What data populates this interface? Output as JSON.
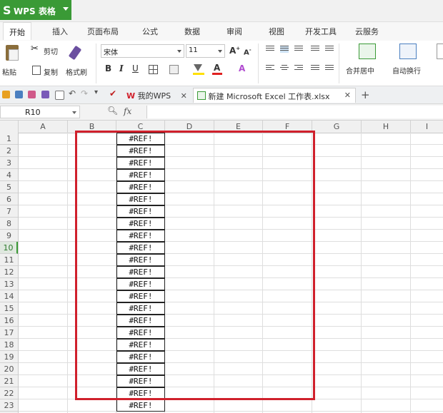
{
  "app": {
    "logo": "S",
    "name": "WPS 表格"
  },
  "ribbon_tabs": [
    "开始",
    "插入",
    "页面布局",
    "公式",
    "数据",
    "审阅",
    "视图",
    "开发工具",
    "云服务"
  ],
  "ribbon": {
    "paste": "粘贴",
    "cut": "剪切",
    "copy": "复制",
    "format_painter": "格式刷",
    "font_name": "宋体",
    "font_size": "11",
    "merge_center": "合并居中",
    "wrap_text": "自动换行"
  },
  "doc_tabs": {
    "wps": "我的WPS",
    "excel": "新建 Microsoft Excel 工作表.xlsx",
    "new_tab": "+"
  },
  "formula_bar": {
    "name_box": "R10",
    "fx": "fx"
  },
  "columns": [
    "A",
    "B",
    "C",
    "D",
    "E",
    "F",
    "G",
    "H",
    "I"
  ],
  "rows": [
    "1",
    "2",
    "3",
    "4",
    "5",
    "6",
    "7",
    "8",
    "9",
    "10",
    "11",
    "12",
    "13",
    "14",
    "15",
    "16",
    "17",
    "18",
    "19",
    "20",
    "21",
    "22",
    "23"
  ],
  "selected_row": "10",
  "cells_c": [
    "#REF!",
    "#REF!",
    "#REF!",
    "#REF!",
    "#REF!",
    "#REF!",
    "#REF!",
    "#REF!",
    "#REF!",
    "#REF!",
    "#REF!",
    "#REF!",
    "#REF!",
    "#REF!",
    "#REF!",
    "#REF!",
    "#REF!",
    "#REF!",
    "#REF!",
    "#REF!",
    "#REF!",
    "#REF!",
    "#REF!"
  ],
  "colors": {
    "brand": "#3a9a36",
    "highlight": "#d0202c"
  }
}
